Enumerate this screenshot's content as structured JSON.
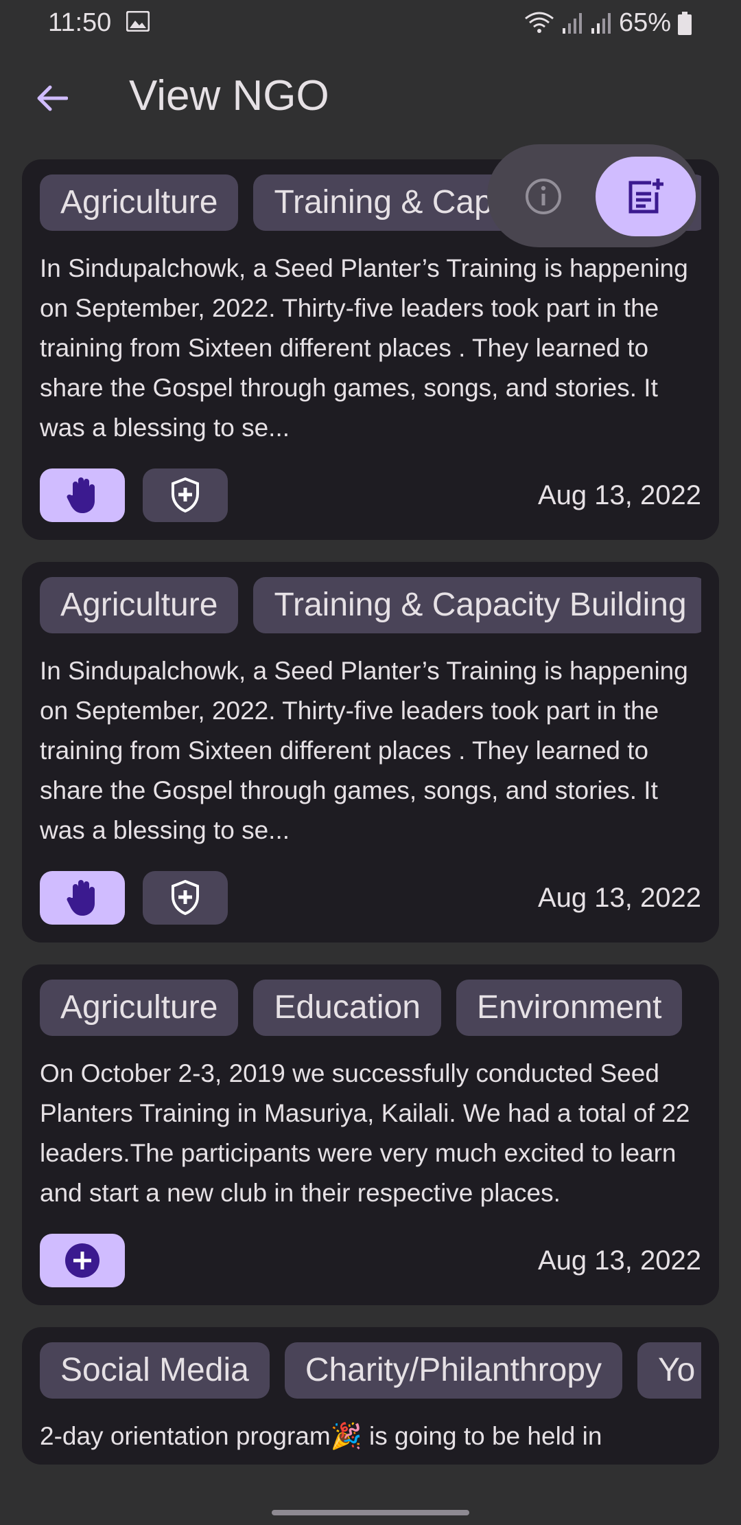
{
  "status_bar": {
    "time": "11:50",
    "battery": "65%"
  },
  "app_bar": {
    "title": "View NGO"
  },
  "colors": {
    "background": "#303031",
    "card": "#1e1c22",
    "chip": "#4a4458",
    "accent": "#d0bcff",
    "accent_dark": "#3b1a8f"
  },
  "cards": [
    {
      "chips": [
        "Agriculture",
        "Training & Capacity Building"
      ],
      "text": "In Sindupalchowk, a Seed Planter’s Training is happening on September, 2022. Thirty-five leaders took part in the training from Sixteen different places . They learned to share the Gospel through games, songs, and stories. It was a blessing to se...",
      "date": "Aug 13, 2022",
      "actions": [
        "hand-icon",
        "shield-plus-icon"
      ]
    },
    {
      "chips": [
        "Agriculture",
        "Training & Capacity Building"
      ],
      "text": "In Sindupalchowk, a Seed Planter’s Training is happening on September, 2022. Thirty-five leaders took part in the training from Sixteen different places . They learned to share the Gospel through games, songs, and stories. It was a blessing to se...",
      "date": "Aug 13, 2022",
      "actions": [
        "hand-icon",
        "shield-plus-icon"
      ]
    },
    {
      "chips": [
        "Agriculture",
        "Education",
        "Environment"
      ],
      "text": "On October 2-3, 2019 we successfully conducted Seed Planters Training in   Masuriya, Kailali. We had a total of 22 leaders.The participants were very much excited to learn and start a new club in their respective places.",
      "date": "Aug 13, 2022",
      "actions": [
        "plus-circle-icon"
      ]
    },
    {
      "chips": [
        "Social Media",
        "Charity/Philanthropy",
        "Yo"
      ],
      "text": "2-day orientation program🎉 is going to be held in"
    }
  ]
}
